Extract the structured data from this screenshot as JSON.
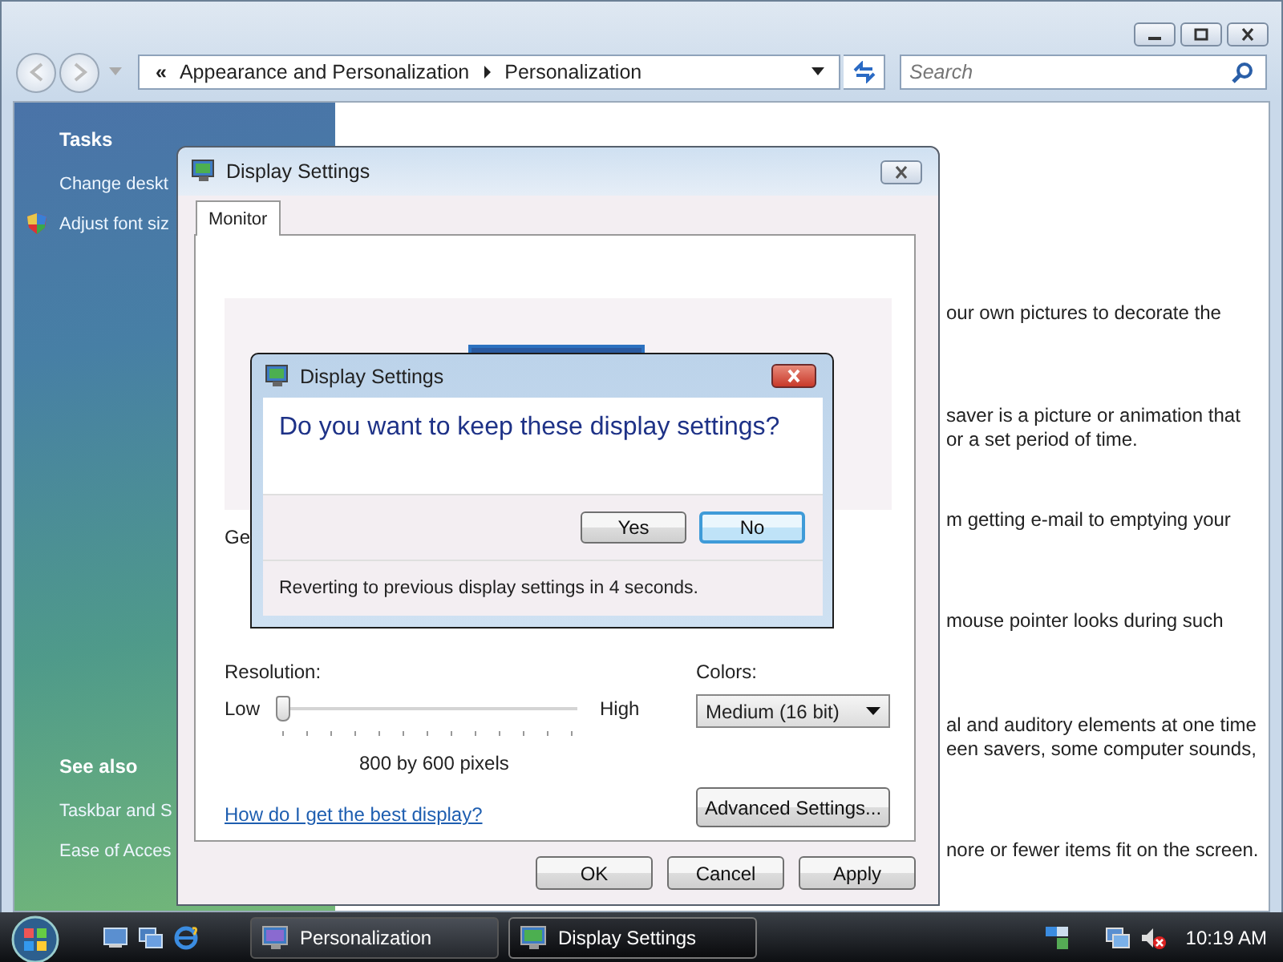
{
  "explorer": {
    "breadcrumb_chevron": "«",
    "breadcrumb": [
      "Appearance and Personalization",
      "Personalization"
    ],
    "search": {
      "placeholder": "Search"
    },
    "tasks_heading": "Tasks",
    "tasks": [
      {
        "label": "Change deskt",
        "kind": "plain"
      },
      {
        "label": "Adjust font siz",
        "kind": "shield"
      }
    ],
    "see_also_heading": "See also",
    "see_also": [
      "Taskbar and S",
      "Ease of Acces"
    ],
    "descriptions": [
      [
        "our own pictures to decorate the"
      ],
      [
        "saver is a picture or animation that",
        "or a set period of time."
      ],
      [
        "m getting e-mail to emptying your"
      ],
      [
        "mouse pointer looks during such"
      ],
      [
        "al and auditory elements at one time",
        "een savers, some computer sounds,"
      ],
      [
        "nore or fewer items fit on the screen."
      ]
    ]
  },
  "display_dialog": {
    "title": "Display Settings",
    "tabs": [
      {
        "label": "Monitor",
        "selected": true
      }
    ],
    "label_1": "Ge",
    "resolution": {
      "label": "Resolution:",
      "low": "Low",
      "high": "High",
      "level": 0,
      "reading": "800 by 600 pixels"
    },
    "colors": {
      "label": "Colors:",
      "value": "Medium (16 bit)"
    },
    "help_link": "How do I get the best display?",
    "advanced_button": "Advanced Settings...",
    "buttons": [
      "OK",
      "Cancel",
      "Apply"
    ]
  },
  "message_box": {
    "title": "Display Settings",
    "question": "Do you want to keep these display settings?",
    "buttons": [
      {
        "label": "Yes",
        "selected": false
      },
      {
        "label": "No",
        "selected": true
      }
    ],
    "footer": "Reverting to previous display settings in 4 seconds."
  },
  "taskbar": {
    "tasks": [
      {
        "label": "Personalization",
        "selected": false
      },
      {
        "label": "Display Settings",
        "selected": true
      }
    ],
    "clock": "10:19 AM"
  }
}
